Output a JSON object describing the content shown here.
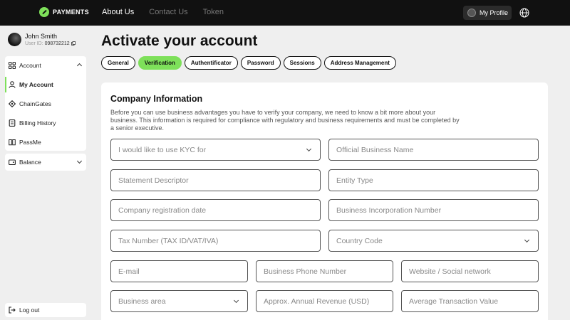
{
  "header": {
    "brand": "PAYMENTS",
    "nav": [
      "About Us",
      "Contact Us",
      "Token"
    ],
    "profile_label": "My Profile"
  },
  "user": {
    "name": "John Smith",
    "id_label": "User ID:",
    "id_value": "098732212"
  },
  "sidebar": {
    "account_label": "Account",
    "items": [
      "My Account",
      "ChainGates",
      "Billing History",
      "PassMe"
    ],
    "balance_label": "Balance",
    "logout_label": "Log out"
  },
  "main": {
    "title": "Activate your account",
    "tabs": [
      "General",
      "Verification",
      "Authentificator",
      "Password",
      "Sessions",
      "Address Management"
    ],
    "active_tab": "Verification"
  },
  "form": {
    "title": "Company Information",
    "description": "Before you can use business advantages you have to verify your company, we need to know a bit more about your business. This information is required for compliance with regulatory and business requirements and must be completed by a senior executive.",
    "fields": {
      "kyc": "I would like to use KYC for",
      "official_name": "Official Business Name",
      "statement": "Statement Descriptor",
      "entity": "Entity Type",
      "reg_date": "Company registration date",
      "inc_number": "Business Incorporation Number",
      "tax": "Tax Number (TAX ID/VAT/IVA)",
      "country": "Country Code",
      "email": "E-mail",
      "phone": "Business Phone Number",
      "website": "Website / Social network",
      "area": "Business area",
      "revenue": "Approx. Annual Revenue (USD)",
      "avg_tx": "Average Transaction Value"
    }
  },
  "colors": {
    "accent": "#7ee05a",
    "topbar": "#111111",
    "background": "#efefef"
  }
}
